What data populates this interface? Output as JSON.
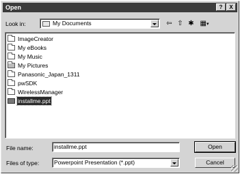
{
  "window": {
    "title": "Open",
    "help_label": "?",
    "close_label": "X"
  },
  "look_in": {
    "label": "Look in:",
    "value": "My Documents"
  },
  "toolbar": {
    "back_glyph": "⇦",
    "up_glyph": "⇧",
    "new_folder_glyph": "✱",
    "view_glyph": "▦"
  },
  "files": [
    {
      "name": "ImageCreator",
      "type": "folder"
    },
    {
      "name": "My eBooks",
      "type": "folder"
    },
    {
      "name": "My Music",
      "type": "folder"
    },
    {
      "name": "My Pictures",
      "type": "folder-pictures"
    },
    {
      "name": "Panasonic_Japan_1311",
      "type": "folder"
    },
    {
      "name": "pwSDK",
      "type": "folder"
    },
    {
      "name": "WirelessManager",
      "type": "folder"
    },
    {
      "name": "installme.ppt",
      "type": "file",
      "selected": true
    }
  ],
  "file_name": {
    "label": "File name:",
    "value": "installme.ppt"
  },
  "file_type": {
    "label": "Files of type:",
    "value": "Powerpoint Presentation (*.ppt)"
  },
  "buttons": {
    "open": "Open",
    "cancel": "Cancel"
  }
}
